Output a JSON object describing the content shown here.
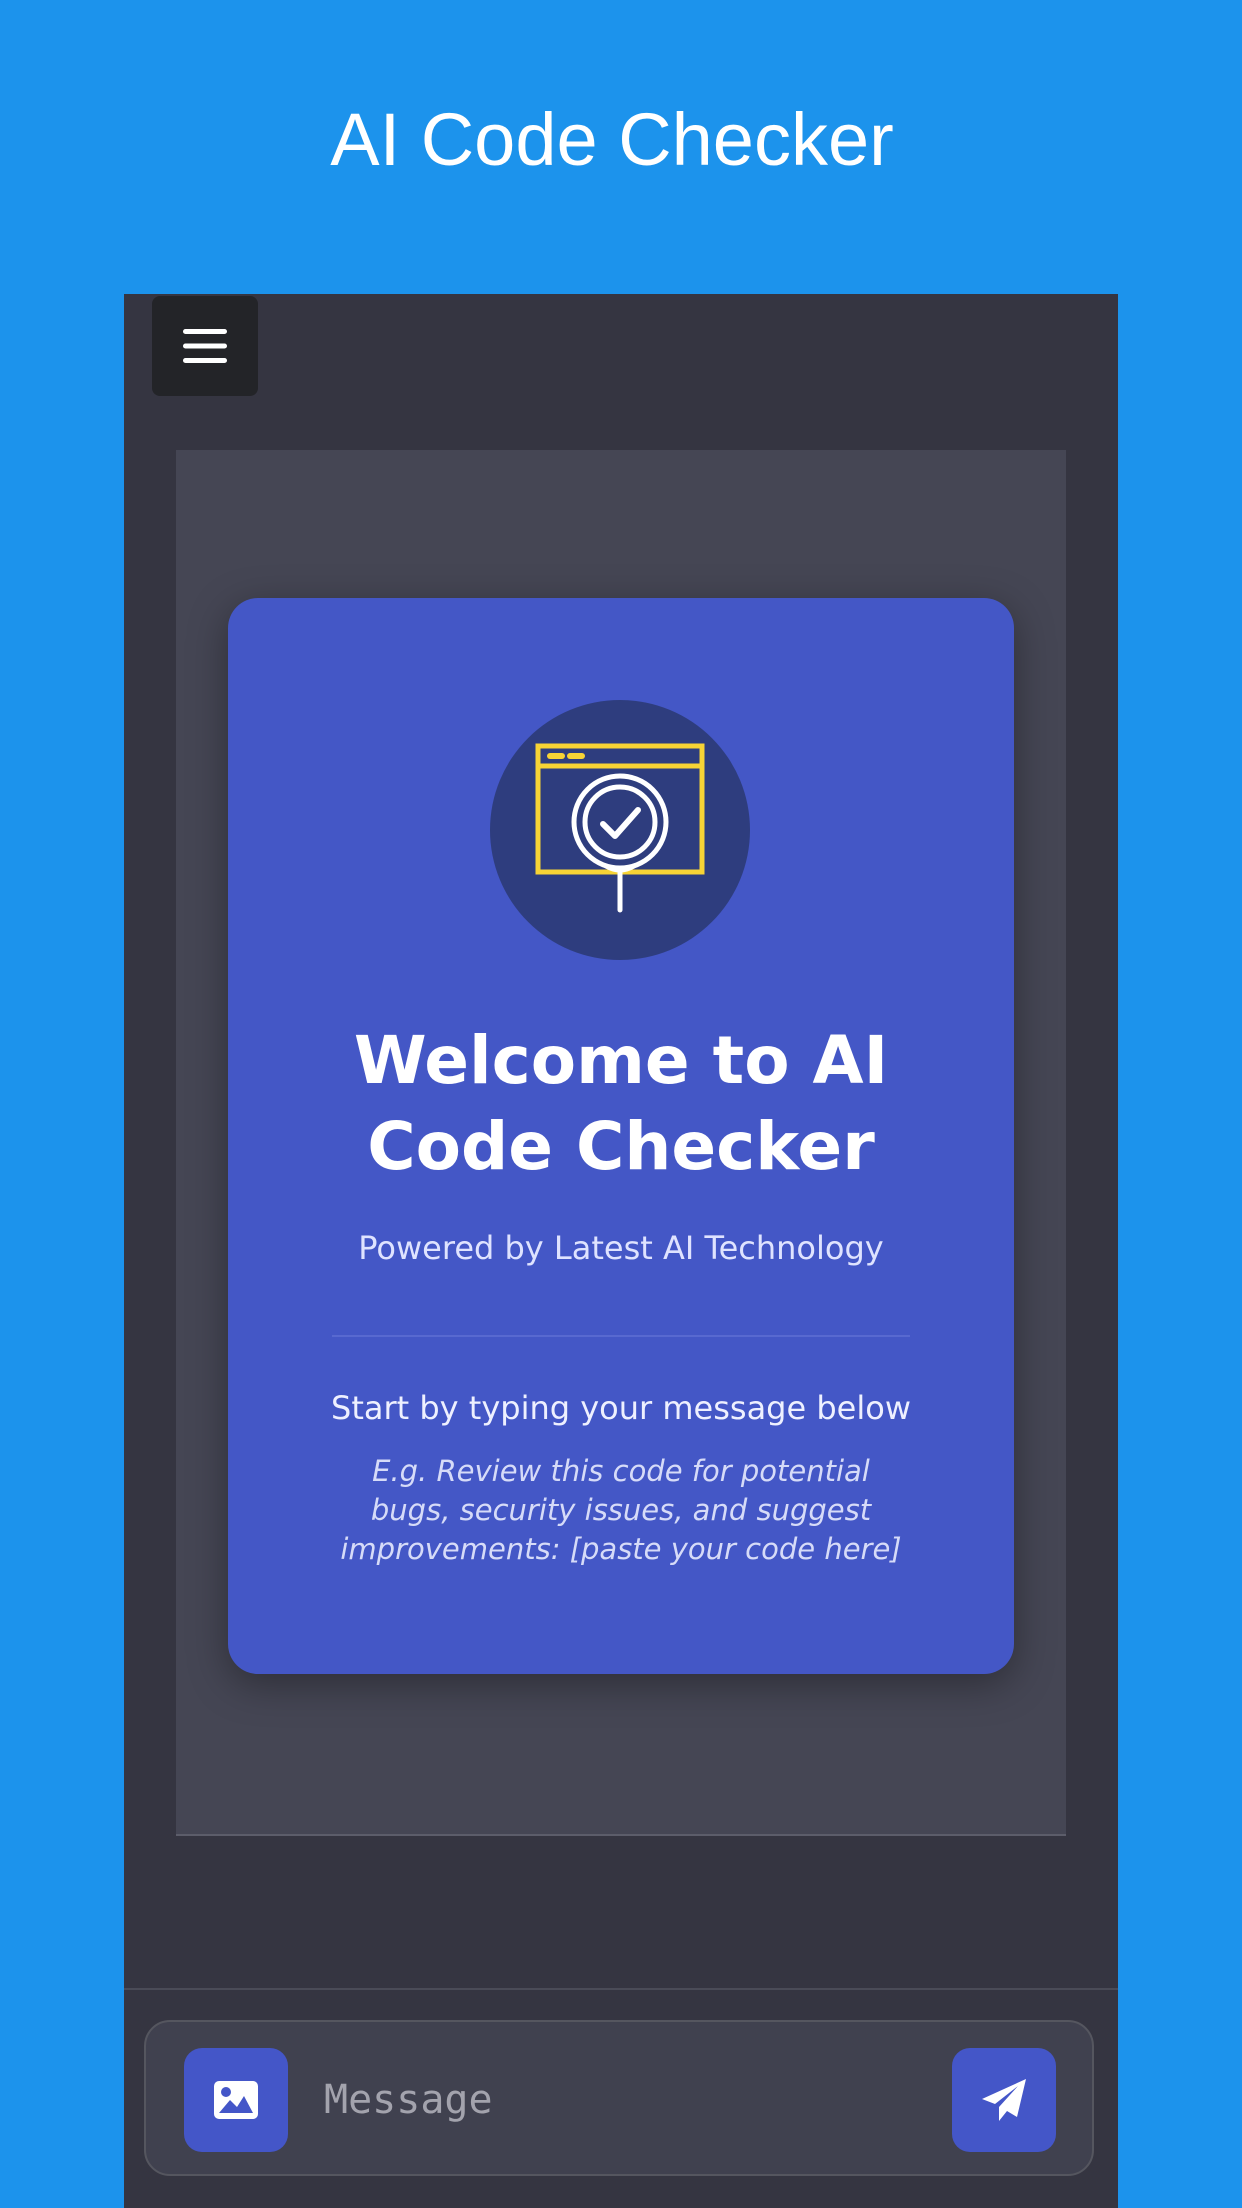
{
  "header": {
    "title": "AI Code Checker"
  },
  "toolbar": {
    "menu_icon": "hamburger-menu-icon"
  },
  "welcome": {
    "logo_icon": "code-check-badge-icon",
    "heading": "Welcome to AI Code Checker",
    "subtitle": "Powered by Latest AI Technology",
    "prompt": "Start by typing your message below",
    "example": "E.g. Review this code for potential bugs, security issues, and suggest improvements: [paste your code here]"
  },
  "composer": {
    "image_icon": "image-upload-icon",
    "placeholder": "Message",
    "value": "",
    "send_icon": "paper-plane-send-icon"
  },
  "colors": {
    "page_background": "#1c93ec",
    "app_background": "#353541",
    "chat_background": "#454654",
    "card_background": "#4457c6",
    "logo_circle": "#2e3d7e",
    "logo_accent": "#f7d335",
    "button_accent": "#4456c8"
  }
}
